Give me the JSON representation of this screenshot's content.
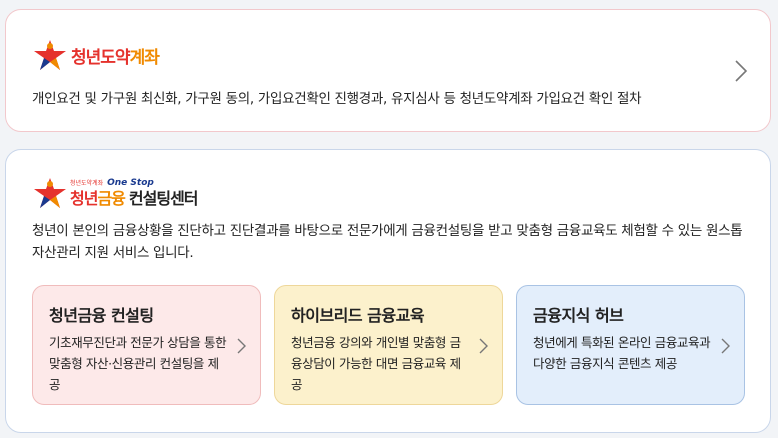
{
  "account_card": {
    "logo_text_part1": "청년도약",
    "logo_text_part2": "계좌",
    "description": "개인요건 및 가구원 최신화, 가구원 동의, 가입요건확인 진행경과, 유지심사 등 청년도약계좌 가입요건 확인 절차"
  },
  "consulting_card": {
    "logo_small": "청년도약계좌",
    "logo_onestop": "One Stop",
    "logo_main_part1": "청년",
    "logo_main_part2": "금융",
    "logo_main_part3": "컨설팅센터",
    "description": "청년이 본인의 금융상황을 진단하고 진단결과를 바탕으로 전문가에게 금융컨설팅을 받고 맞춤형 금융교육도 체험할 수 있는 원스톱 자산관리 지원 서비스 입니다.",
    "services": [
      {
        "title": "청년금융 컨설팅",
        "description": "기초재무진단과 전문가 상담을 통한 맞춤형 자산·신용관리 컨설팅을 제공"
      },
      {
        "title": "하이브리드 금융교육",
        "description": "청년금융 강의와 개인별 맞춤형 금융상담이 가능한 대면 금융교육 제공"
      },
      {
        "title": "금융지식 허브",
        "description": "청년에게 특화된 온라인 금융교육과 다양한 금융지식 콘텐츠 제공"
      }
    ]
  },
  "icons": {
    "logo_mark": "star-person-icon",
    "arrow": "chevron-right-icon"
  },
  "colors": {
    "brand_red": "#e5322d",
    "brand_orange": "#f08a00",
    "brand_blue": "#1a3a8f"
  }
}
